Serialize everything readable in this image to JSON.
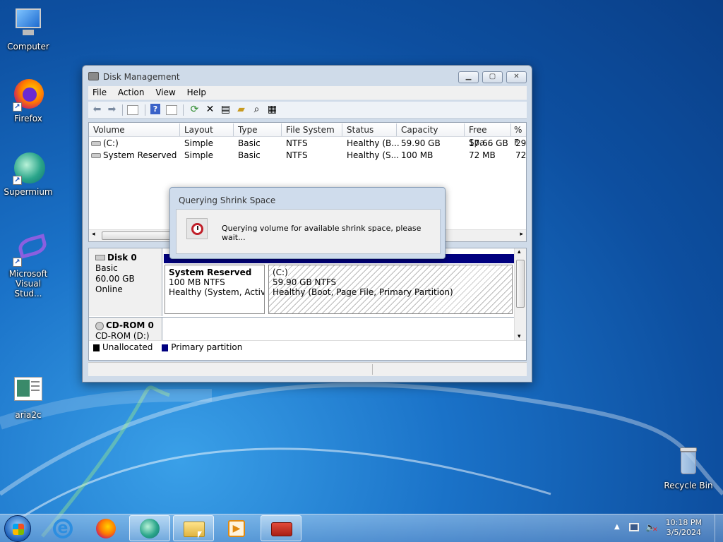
{
  "desktop": {
    "icons": [
      {
        "label": "Computer"
      },
      {
        "label": "Firefox"
      },
      {
        "label": "Supermium"
      },
      {
        "label": "Microsoft Visual Stud..."
      },
      {
        "label": "aria2c"
      },
      {
        "label": "Recycle Bin"
      }
    ]
  },
  "window": {
    "title": "Disk Management",
    "menu": [
      "File",
      "Action",
      "View",
      "Help"
    ],
    "columns": [
      "Volume",
      "Layout",
      "Type",
      "File System",
      "Status",
      "Capacity",
      "Free Spa...",
      "% F"
    ],
    "volumes": [
      {
        "volume": "(C:)",
        "layout": "Simple",
        "type": "Basic",
        "fs": "NTFS",
        "status": "Healthy (B...",
        "capacity": "59.90 GB",
        "free": "17.66 GB",
        "pct": "29"
      },
      {
        "volume": "System Reserved",
        "layout": "Simple",
        "type": "Basic",
        "fs": "NTFS",
        "status": "Healthy (S...",
        "capacity": "100 MB",
        "free": "72 MB",
        "pct": "72"
      }
    ],
    "disks": [
      {
        "name": "Disk 0",
        "type": "Basic",
        "size": "60.00 GB",
        "state": "Online"
      },
      {
        "name": "CD-ROM 0",
        "type": "CD-ROM (D:)"
      }
    ],
    "partitions": [
      {
        "name": "System Reserved",
        "size": "100 MB NTFS",
        "status": "Healthy (System, Active,"
      },
      {
        "name": "(C:)",
        "size": "59.90 GB NTFS",
        "status": "Healthy (Boot, Page File, Primary Partition)"
      }
    ],
    "legend": [
      "Unallocated",
      "Primary partition"
    ]
  },
  "dialog": {
    "title": "Querying Shrink Space",
    "message": "Querying volume for available shrink space, please wait..."
  },
  "taskbar": {
    "time": "10:18 PM",
    "date": "3/5/2024"
  },
  "colors": {
    "primary_partition": "#00007f",
    "unallocated": "#000000"
  }
}
